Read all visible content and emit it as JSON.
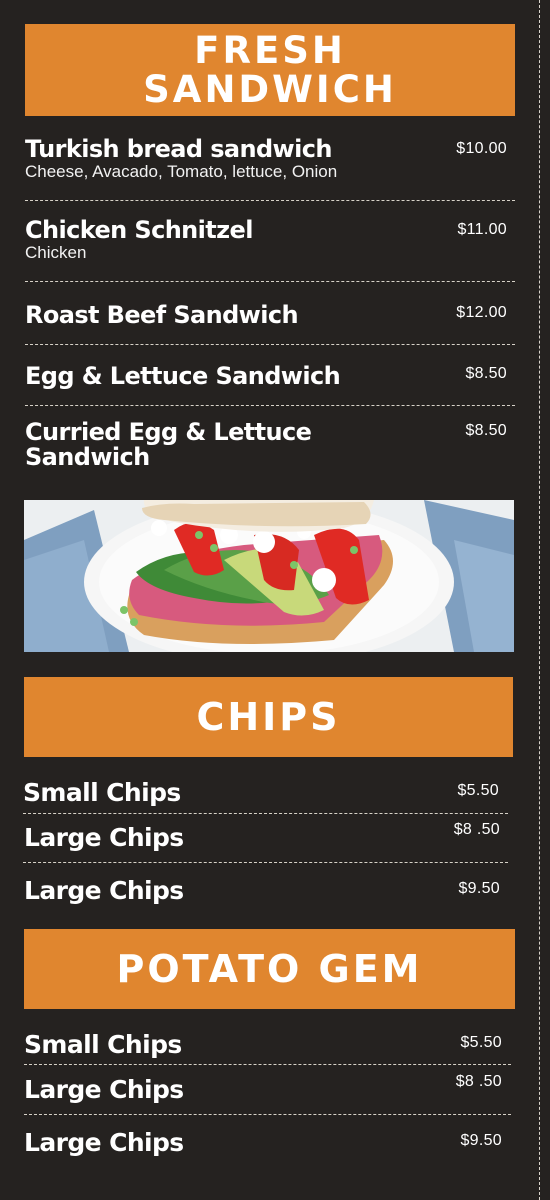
{
  "sections": {
    "sandwich": {
      "title_line1": "FRESH",
      "title_line2": "SANDWICH",
      "items": [
        {
          "name": "Turkish bread sandwich",
          "desc": "Cheese, Avacado, Tomato, lettuce, Onion",
          "price": "$10.00"
        },
        {
          "name": "Chicken Schnitzel",
          "desc": "Chicken",
          "price": "$11.00"
        },
        {
          "name": "Roast Beef Sandwich",
          "price": "$12.00"
        },
        {
          "name": "Egg & Lettuce Sandwich",
          "price": "$8.50"
        },
        {
          "name_line1": "Curried Egg & Lettuce",
          "name_line2": "Sandwich",
          "price": "$8.50"
        }
      ]
    },
    "chips": {
      "title": "CHIPS",
      "items": [
        {
          "name": "Small Chips",
          "price": "$5.50"
        },
        {
          "name": "Large Chips",
          "price": "$8 .50"
        },
        {
          "name": "Large Chips",
          "price": "$9.50"
        }
      ]
    },
    "potato_gem": {
      "title": "POTATO GEM",
      "items": [
        {
          "name": "Small Chips",
          "price": "$5.50"
        },
        {
          "name": "Large Chips",
          "price": "$8 .50"
        },
        {
          "name": "Large Chips",
          "price": "$9.50"
        }
      ]
    }
  },
  "colors": {
    "background": "#252220",
    "banner": "#e0862f",
    "text": "#ffffff"
  },
  "image": {
    "icon": "sandwich-photo"
  }
}
